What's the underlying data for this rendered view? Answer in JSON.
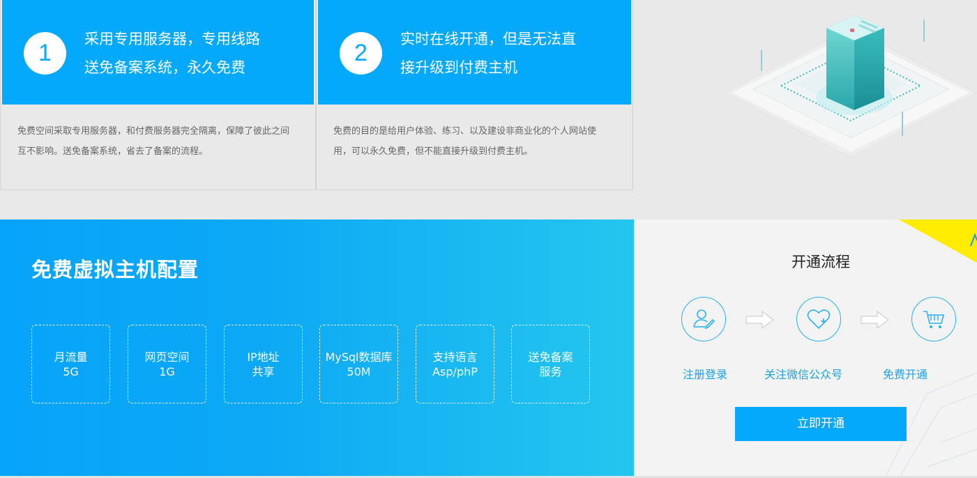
{
  "features": [
    {
      "number": "1",
      "title_line1": "采用专用服务器，专用线路",
      "title_line2": "送免备案系统，永久免费",
      "desc": "免费空间采取专用服务器，和付费服务器完全隔离，保障了彼此之间互不影响。送免备案系统，省去了备案的流程。"
    },
    {
      "number": "2",
      "title_line1": "实时在线开通，但是无法直",
      "title_line2": "接升级到付费主机",
      "desc": "免费的目的是给用户体验、练习、以及建设非商业化的个人网站使用，可以永久免费，但不能直接升级到付费主机。"
    }
  ],
  "config": {
    "title": "免费虚拟主机配置",
    "specs": [
      {
        "line1": "月流量",
        "line2": "5G"
      },
      {
        "line1": "网页空间",
        "line2": "1G"
      },
      {
        "line1": "IP地址",
        "line2": "共享"
      },
      {
        "line1": "MySql数据库",
        "line2": "50M"
      },
      {
        "line1": "支持语言",
        "line2": "Asp/phP"
      },
      {
        "line1": "送免备案",
        "line2": "服务"
      }
    ]
  },
  "process": {
    "title": "开通流程",
    "steps": [
      {
        "label": "注册登录",
        "icon": "user-edit-icon"
      },
      {
        "label": "关注微信公众号",
        "icon": "heart-plus-icon"
      },
      {
        "label": "免费开通",
        "icon": "shopping-cart-icon"
      }
    ],
    "button_label": "立即开通"
  },
  "colors": {
    "accent": "#04a9fb",
    "gradient_end": "#25c6ee",
    "step_blue": "#1da2e4",
    "corner_yellow": "#ffec00"
  }
}
